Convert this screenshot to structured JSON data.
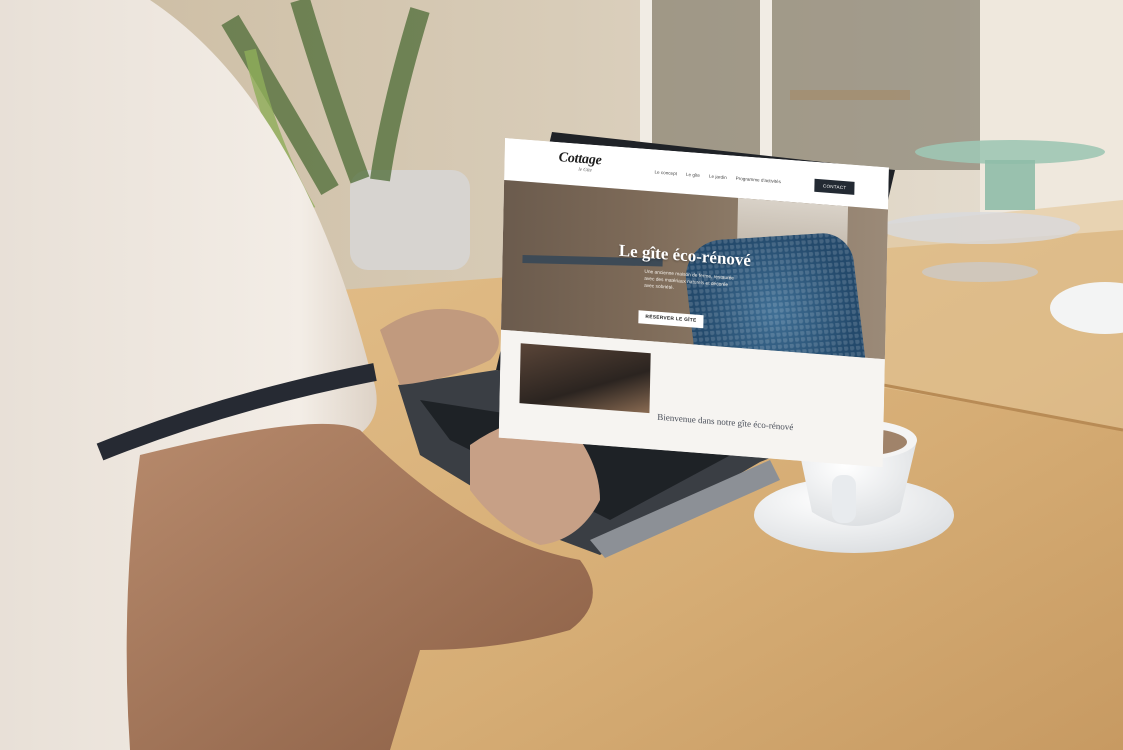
{
  "website": {
    "logo": {
      "word": "Cottage",
      "sub": "le Gîte"
    },
    "nav": [
      "Le concept",
      "Le gîte",
      "Le jardin",
      "Programme d'activités"
    ],
    "contact_label": "CONTACT",
    "hero": {
      "title": "Le gîte éco-rénové",
      "text": "Une ancienne maison de ferme, restaurée avec des matériaux naturels et décorée avec sobriété.",
      "cta_label": "RÉSERVER LE GÎTE"
    },
    "section2_heading": "Bienvenue dans notre gîte éco-rénové"
  },
  "colors": {
    "shirt": "#efe7df",
    "desk": "#d8b17c",
    "laptop": "#2d3035",
    "blanket": "#2f5f87",
    "contact_button": "#232a33"
  }
}
